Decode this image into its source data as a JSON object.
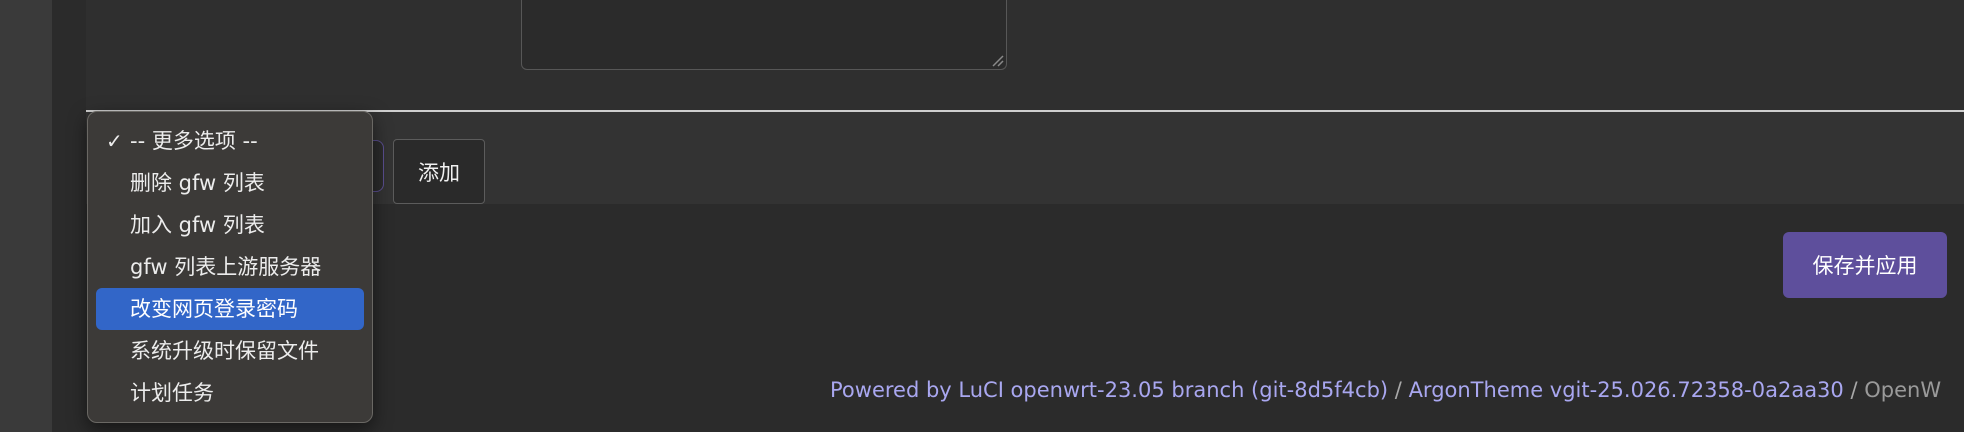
{
  "form": {
    "add_label": "添加",
    "save_apply_label": "保存并应用"
  },
  "dropdown": {
    "options": [
      {
        "label": "-- 更多选项 --",
        "selected": true
      },
      {
        "label": "删除 gfw 列表"
      },
      {
        "label": "加入 gfw 列表"
      },
      {
        "label": "gfw 列表上游服务器"
      },
      {
        "label": "改变网页登录密码",
        "highlighted": true
      },
      {
        "label": "系统升级时保留文件"
      },
      {
        "label": "计划任务"
      }
    ],
    "check_glyph": "✓"
  },
  "footer": {
    "luci": "Powered by LuCI openwrt-23.05 branch (git-8d5f4cb)",
    "separator": "/",
    "theme": "ArgonTheme vgit-25.026.72358-0a2aa30",
    "openwrt": "OpenW"
  },
  "colors": {
    "accent": "#5e4f9c",
    "highlight": "#3266c8",
    "link": "#a9a7f0"
  }
}
